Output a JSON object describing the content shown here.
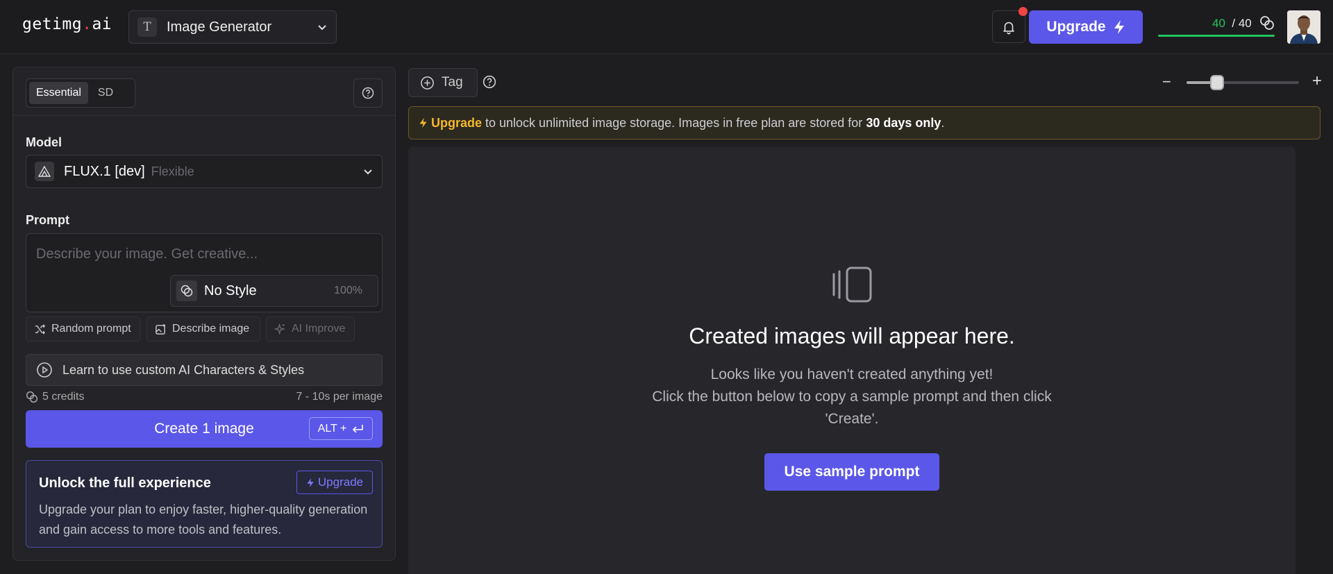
{
  "header": {
    "logo_text": "getimg",
    "logo_dot": ".",
    "logo_suffix": "ai",
    "tool_icon_letter": "T",
    "tool_name": "Image Generator",
    "upgrade_label": "Upgrade",
    "credits_current": "40",
    "credits_total": "/ 40",
    "credits_fraction": 1.0,
    "icons": [
      "chevron-down-icon",
      "bell-icon",
      "lightning-icon",
      "coins-icon"
    ]
  },
  "sidebar": {
    "tabs": [
      "Essential",
      "SD"
    ],
    "active_tab": "Essential",
    "model_label": "Model",
    "model_name": "FLUX.1 [dev]",
    "model_sub": "Flexible",
    "prompt_label": "Prompt",
    "prompt_placeholder": "Describe your image. Get creative...",
    "style_name": "No Style",
    "style_strength": "100%",
    "actions": [
      "Random prompt",
      "Describe image",
      "AI Improve"
    ],
    "learn_text": "Learn to use custom AI Characters & Styles",
    "cost": "5 credits",
    "time": "7 - 10s per image",
    "create_label": "Create 1 image",
    "shortcut": "ALT +",
    "unlock_title": "Unlock the full experience",
    "unlock_button": "Upgrade",
    "unlock_desc": "Upgrade your plan to enjoy faster, higher-quality generation and gain access to more tools and features."
  },
  "main": {
    "tag_label": "Tag",
    "zoom_level": 0.27,
    "banner_upgrade": "Upgrade",
    "banner_text_1": " to unlock unlimited image storage. Images in free plan are stored for ",
    "banner_bold": "30 days only",
    "banner_end": ".",
    "empty_title": "Created images will appear here.",
    "empty_line1": "Looks like you haven't created anything yet!",
    "empty_line2": "Click the button below to copy a sample prompt and then click 'Create'.",
    "sample_button": "Use sample prompt"
  },
  "colors": {
    "accent": "#5b57e8",
    "credit_green": "#22c55e",
    "banner_gold": "#f5b82e",
    "notification_red": "#ef4444"
  }
}
